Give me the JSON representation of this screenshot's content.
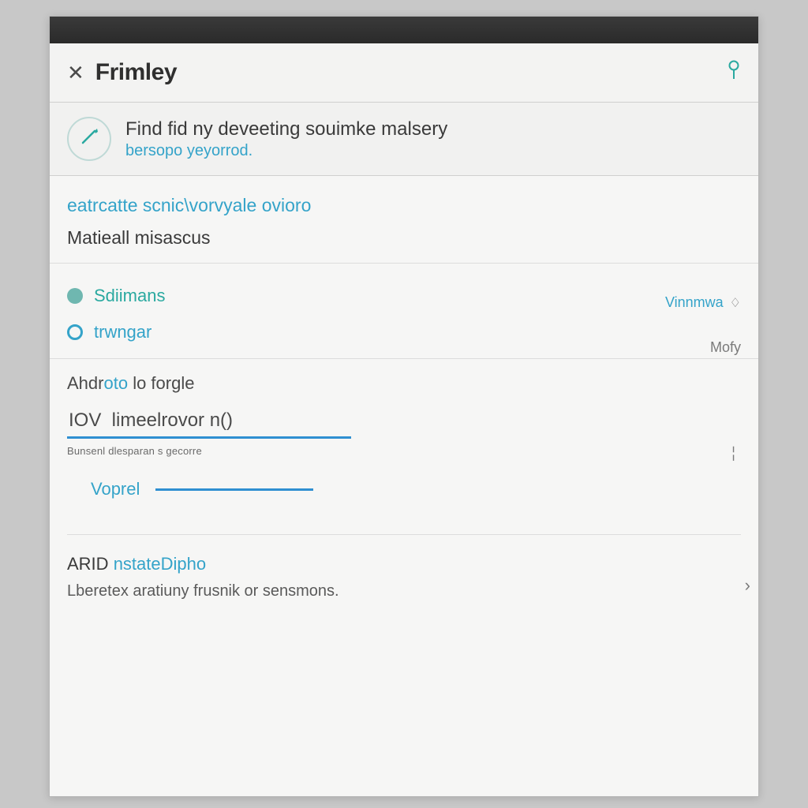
{
  "header": {
    "title": "Frimley"
  },
  "search": {
    "main_text": "Find fid ny deveeting souimke malsery",
    "sub_text": "bersopo yeyorrod."
  },
  "section1": {
    "link_text": "eatrcatte scnic\\vorvyale ovioro",
    "label_text": "Matieall misascus",
    "item1_text": "Sdiimans",
    "item2_text": "trwngar"
  },
  "side_tags": {
    "tag1_text": "Vinnmwa",
    "tag2_text": "Mofy"
  },
  "section2": {
    "title_part1": "Ahdr",
    "title_part2": "oto",
    "title_part3": " lo forgle",
    "input_value": "IOV  limeelrovor n()",
    "caption": "Bunsenl dlesparan s gecorre",
    "vop_label": "Voprel"
  },
  "section3": {
    "head_prefix": "ARID ",
    "head_accent": "nstateDipho",
    "body_text": "Lberetex aratiuny frusnik or sensmons."
  }
}
